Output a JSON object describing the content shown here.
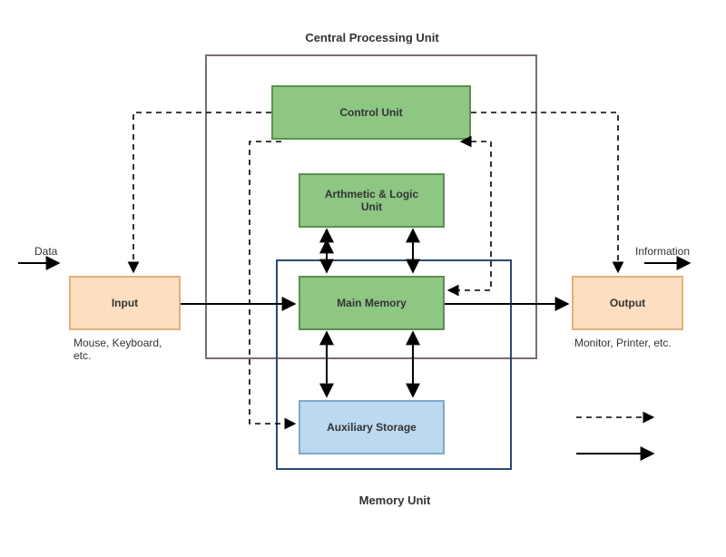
{
  "title_cpu": "Central Processing Unit",
  "title_mem": "Memory Unit",
  "blocks": {
    "control": "Control Unit",
    "alu": "Arthmetic & Logic\nUnit",
    "main_memory": "Main Memory",
    "aux_storage": "Auxiliary Storage",
    "input": "Input",
    "output": "Output"
  },
  "labels": {
    "data": "Data",
    "information": "Information",
    "input_sub": "Mouse, Keyboard,\netc.",
    "output_sub": "Monitor, Printer, etc."
  },
  "diagram": {
    "type": "block-diagram",
    "description": "Von Neumann computer architecture showing data and control flows between Input, Output, CPU (Control Unit + ALU), and Memory Unit (Main Memory + Auxiliary Storage).",
    "containers": [
      {
        "id": "cpu",
        "label": "Central Processing Unit",
        "contains": [
          "control",
          "alu",
          "main_memory"
        ]
      },
      {
        "id": "memory_unit",
        "label": "Memory Unit",
        "contains": [
          "main_memory",
          "aux_storage"
        ]
      }
    ],
    "nodes": [
      {
        "id": "input",
        "label": "Input",
        "note": "Mouse, Keyboard, etc."
      },
      {
        "id": "output",
        "label": "Output",
        "note": "Monitor, Printer, etc."
      },
      {
        "id": "control",
        "label": "Control Unit"
      },
      {
        "id": "alu",
        "label": "Arthmetic & Logic Unit"
      },
      {
        "id": "main_memory",
        "label": "Main Memory"
      },
      {
        "id": "aux_storage",
        "label": "Auxiliary Storage"
      },
      {
        "id": "data_source",
        "label": "Data"
      },
      {
        "id": "info_sink",
        "label": "Information"
      }
    ],
    "edges": [
      {
        "from": "data_source",
        "to": "input",
        "kind": "data"
      },
      {
        "from": "input",
        "to": "main_memory",
        "kind": "data"
      },
      {
        "from": "main_memory",
        "to": "output",
        "kind": "data"
      },
      {
        "from": "output",
        "to": "info_sink",
        "kind": "data"
      },
      {
        "from": "main_memory",
        "to": "alu",
        "kind": "data",
        "bidirectional": true
      },
      {
        "from": "main_memory",
        "to": "aux_storage",
        "kind": "data",
        "bidirectional": true
      },
      {
        "from": "control",
        "to": "input",
        "kind": "control"
      },
      {
        "from": "control",
        "to": "output",
        "kind": "control"
      },
      {
        "from": "control",
        "to": "main_memory",
        "kind": "control",
        "bidirectional": true
      },
      {
        "from": "control",
        "to": "aux_storage",
        "kind": "control"
      }
    ],
    "legend": [
      {
        "kind": "control",
        "style": "dashed arrow"
      },
      {
        "kind": "data",
        "style": "solid arrow"
      }
    ]
  }
}
